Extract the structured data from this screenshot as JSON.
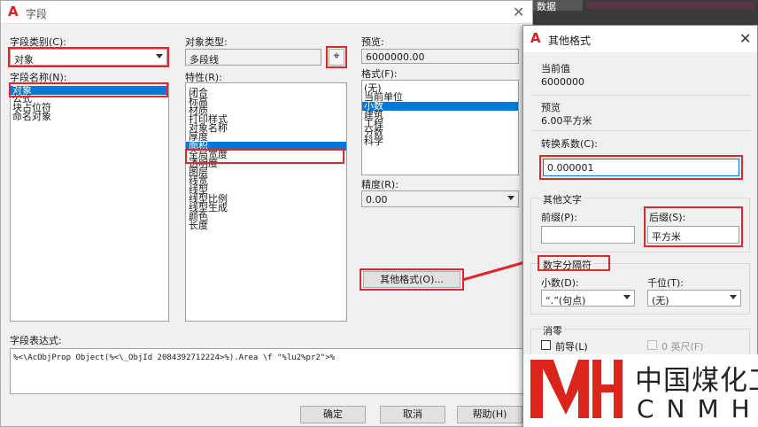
{
  "background_top_right": {
    "label": "数据"
  },
  "field_dialog": {
    "title": "字段",
    "category_label": "字段类别(C):",
    "category_value": "对象",
    "name_label": "字段名称(N):",
    "names": [
      "对象",
      "公式",
      "块占位符",
      "命名对象"
    ],
    "object_type_label": "对象类型:",
    "object_type_value": "多段线",
    "properties_label": "特性(R):",
    "properties": [
      "闭合",
      "标高",
      "材质",
      "打印样式",
      "对象名称",
      "厚度",
      "面积",
      "全局宽度",
      "透明度",
      "图层",
      "线宽",
      "线型",
      "线型比例",
      "线型生成",
      "颜色",
      "长度"
    ],
    "preview_label": "预览:",
    "preview_value": "6000000.00",
    "format_label": "格式(F):",
    "formats": [
      "(无)",
      "当前单位",
      "小数",
      "建筑",
      "工程",
      "分数",
      "科学"
    ],
    "precision_label": "精度(R):",
    "precision_value": "0.00",
    "other_format_button": "其他格式(O)...",
    "expression_label": "字段表达式:",
    "expression_value": "%<\\AcObjProp Object(%<\\_ObjId 2084392712224>%).Area \\f \"%lu2%pr2\">%",
    "ok_button": "确定",
    "cancel_button": "取消",
    "help_button": "帮助(H)"
  },
  "other_format_dialog": {
    "title": "其他格式",
    "current_value_label": "当前值",
    "current_value": "6000000",
    "preview_label": "预览",
    "preview_value": "6.00平方米",
    "conversion_label": "转换系数(C):",
    "conversion_value": "0.000001",
    "additional_text_label": "其他文字",
    "prefix_label": "前缀(P):",
    "prefix_value": "",
    "suffix_label": "后缀(S):",
    "suffix_value": "平方米",
    "number_separators_label": "数字分隔符",
    "decimal_label": "小数(D):",
    "decimal_value": "“.”(句点)",
    "thousands_label": "千位(T):",
    "thousands_value": "(无)",
    "zero_suppression_label": "消零",
    "leading_label": "前导(L)",
    "feet_label": "0 英尺(F)"
  },
  "watermark": {
    "cn": "中国煤化工",
    "en": "CNMHG",
    "logo_letters": "MH"
  },
  "colors": {
    "highlight": "#e0272d",
    "selection": "#0078d7",
    "autocad_red": "#d61f26"
  }
}
